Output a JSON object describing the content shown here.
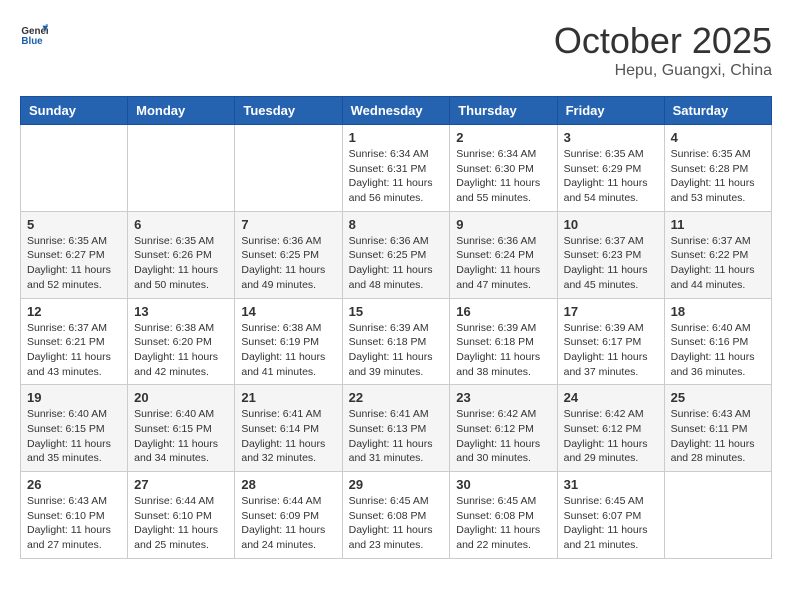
{
  "header": {
    "logo_general": "General",
    "logo_blue": "Blue",
    "month": "October 2025",
    "location": "Hepu, Guangxi, China"
  },
  "days_of_week": [
    "Sunday",
    "Monday",
    "Tuesday",
    "Wednesday",
    "Thursday",
    "Friday",
    "Saturday"
  ],
  "weeks": [
    [
      {
        "day": "",
        "info": ""
      },
      {
        "day": "",
        "info": ""
      },
      {
        "day": "",
        "info": ""
      },
      {
        "day": "1",
        "info": "Sunrise: 6:34 AM\nSunset: 6:31 PM\nDaylight: 11 hours\nand 56 minutes."
      },
      {
        "day": "2",
        "info": "Sunrise: 6:34 AM\nSunset: 6:30 PM\nDaylight: 11 hours\nand 55 minutes."
      },
      {
        "day": "3",
        "info": "Sunrise: 6:35 AM\nSunset: 6:29 PM\nDaylight: 11 hours\nand 54 minutes."
      },
      {
        "day": "4",
        "info": "Sunrise: 6:35 AM\nSunset: 6:28 PM\nDaylight: 11 hours\nand 53 minutes."
      }
    ],
    [
      {
        "day": "5",
        "info": "Sunrise: 6:35 AM\nSunset: 6:27 PM\nDaylight: 11 hours\nand 52 minutes."
      },
      {
        "day": "6",
        "info": "Sunrise: 6:35 AM\nSunset: 6:26 PM\nDaylight: 11 hours\nand 50 minutes."
      },
      {
        "day": "7",
        "info": "Sunrise: 6:36 AM\nSunset: 6:25 PM\nDaylight: 11 hours\nand 49 minutes."
      },
      {
        "day": "8",
        "info": "Sunrise: 6:36 AM\nSunset: 6:25 PM\nDaylight: 11 hours\nand 48 minutes."
      },
      {
        "day": "9",
        "info": "Sunrise: 6:36 AM\nSunset: 6:24 PM\nDaylight: 11 hours\nand 47 minutes."
      },
      {
        "day": "10",
        "info": "Sunrise: 6:37 AM\nSunset: 6:23 PM\nDaylight: 11 hours\nand 45 minutes."
      },
      {
        "day": "11",
        "info": "Sunrise: 6:37 AM\nSunset: 6:22 PM\nDaylight: 11 hours\nand 44 minutes."
      }
    ],
    [
      {
        "day": "12",
        "info": "Sunrise: 6:37 AM\nSunset: 6:21 PM\nDaylight: 11 hours\nand 43 minutes."
      },
      {
        "day": "13",
        "info": "Sunrise: 6:38 AM\nSunset: 6:20 PM\nDaylight: 11 hours\nand 42 minutes."
      },
      {
        "day": "14",
        "info": "Sunrise: 6:38 AM\nSunset: 6:19 PM\nDaylight: 11 hours\nand 41 minutes."
      },
      {
        "day": "15",
        "info": "Sunrise: 6:39 AM\nSunset: 6:18 PM\nDaylight: 11 hours\nand 39 minutes."
      },
      {
        "day": "16",
        "info": "Sunrise: 6:39 AM\nSunset: 6:18 PM\nDaylight: 11 hours\nand 38 minutes."
      },
      {
        "day": "17",
        "info": "Sunrise: 6:39 AM\nSunset: 6:17 PM\nDaylight: 11 hours\nand 37 minutes."
      },
      {
        "day": "18",
        "info": "Sunrise: 6:40 AM\nSunset: 6:16 PM\nDaylight: 11 hours\nand 36 minutes."
      }
    ],
    [
      {
        "day": "19",
        "info": "Sunrise: 6:40 AM\nSunset: 6:15 PM\nDaylight: 11 hours\nand 35 minutes."
      },
      {
        "day": "20",
        "info": "Sunrise: 6:40 AM\nSunset: 6:15 PM\nDaylight: 11 hours\nand 34 minutes."
      },
      {
        "day": "21",
        "info": "Sunrise: 6:41 AM\nSunset: 6:14 PM\nDaylight: 11 hours\nand 32 minutes."
      },
      {
        "day": "22",
        "info": "Sunrise: 6:41 AM\nSunset: 6:13 PM\nDaylight: 11 hours\nand 31 minutes."
      },
      {
        "day": "23",
        "info": "Sunrise: 6:42 AM\nSunset: 6:12 PM\nDaylight: 11 hours\nand 30 minutes."
      },
      {
        "day": "24",
        "info": "Sunrise: 6:42 AM\nSunset: 6:12 PM\nDaylight: 11 hours\nand 29 minutes."
      },
      {
        "day": "25",
        "info": "Sunrise: 6:43 AM\nSunset: 6:11 PM\nDaylight: 11 hours\nand 28 minutes."
      }
    ],
    [
      {
        "day": "26",
        "info": "Sunrise: 6:43 AM\nSunset: 6:10 PM\nDaylight: 11 hours\nand 27 minutes."
      },
      {
        "day": "27",
        "info": "Sunrise: 6:44 AM\nSunset: 6:10 PM\nDaylight: 11 hours\nand 25 minutes."
      },
      {
        "day": "28",
        "info": "Sunrise: 6:44 AM\nSunset: 6:09 PM\nDaylight: 11 hours\nand 24 minutes."
      },
      {
        "day": "29",
        "info": "Sunrise: 6:45 AM\nSunset: 6:08 PM\nDaylight: 11 hours\nand 23 minutes."
      },
      {
        "day": "30",
        "info": "Sunrise: 6:45 AM\nSunset: 6:08 PM\nDaylight: 11 hours\nand 22 minutes."
      },
      {
        "day": "31",
        "info": "Sunrise: 6:45 AM\nSunset: 6:07 PM\nDaylight: 11 hours\nand 21 minutes."
      },
      {
        "day": "",
        "info": ""
      }
    ]
  ]
}
